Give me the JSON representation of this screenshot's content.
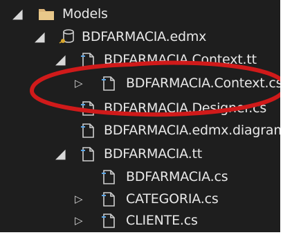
{
  "tree": {
    "models": "Models",
    "edmx": "BDFARMACIA.edmx",
    "context_tt": "BDFARMACIA.Context.tt",
    "context_cs": "BDFARMACIA.Context.cs",
    "designer_cs": "BDFARMACIA.Designer.cs",
    "diagram": "BDFARMACIA.edmx.diagram",
    "tt": "BDFARMACIA.tt",
    "bdfarmacia_cs": "BDFARMACIA.cs",
    "categoria_cs": "CATEGORIA.cs",
    "cliente_cs": "CLIENTE.cs"
  },
  "colors": {
    "background": "#1e1e1e",
    "text": "#e8e8e8",
    "annotation": "#d01a1a",
    "folder": "#dcb67a"
  }
}
